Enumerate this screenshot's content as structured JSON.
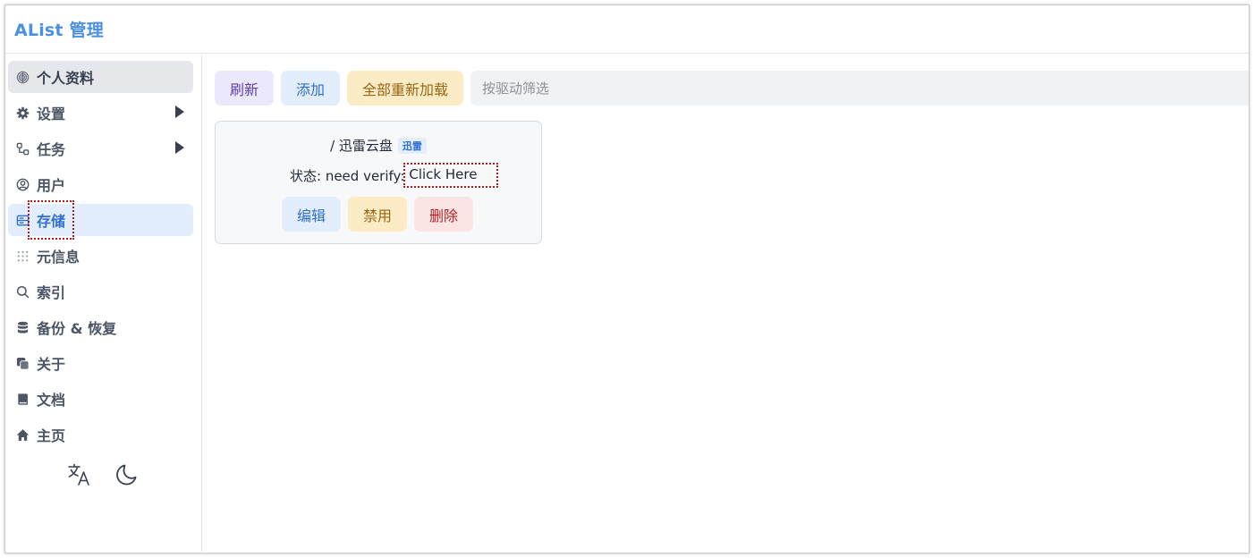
{
  "app": {
    "title": "AList 管理"
  },
  "sidebar": {
    "items": [
      {
        "label": "个人资料",
        "icon": "fingerprint-icon"
      },
      {
        "label": "设置",
        "icon": "gear-icon",
        "expandable": true
      },
      {
        "label": "任务",
        "icon": "workflow-icon",
        "expandable": true
      },
      {
        "label": "用户",
        "icon": "user-circle-icon"
      },
      {
        "label": "存储",
        "icon": "storage-icon",
        "active": true
      },
      {
        "label": "元信息",
        "icon": "grid-dots-icon"
      },
      {
        "label": "索引",
        "icon": "search-icon"
      },
      {
        "label": "备份 & 恢复",
        "icon": "database-icon"
      },
      {
        "label": "关于",
        "icon": "copy-icon"
      },
      {
        "label": "文档",
        "icon": "book-icon"
      },
      {
        "label": "主页",
        "icon": "home-icon"
      }
    ],
    "tools": [
      {
        "icon": "translate-icon"
      },
      {
        "icon": "moon-icon"
      }
    ]
  },
  "toolbar": {
    "refresh_label": "刷新",
    "add_label": "添加",
    "reload_all_label": "全部重新加载",
    "filter_placeholder": "按驱动筛选",
    "filter_value": ""
  },
  "storages": [
    {
      "mount_path": "/ 迅雷云盘",
      "driver_badge": "迅雷",
      "status_label": "状态: need verify:",
      "status_link": "Click Here",
      "edit_label": "编辑",
      "disable_label": "禁用",
      "delete_label": "删除"
    }
  ],
  "colors": {
    "brand": "#4a90e2",
    "active_bg": "#e2eefb",
    "active_text": "#2f6fd1",
    "purple_bg": "#ece8fb",
    "yellow_bg": "#fcecc6",
    "red_bg": "#fbe4e4"
  }
}
